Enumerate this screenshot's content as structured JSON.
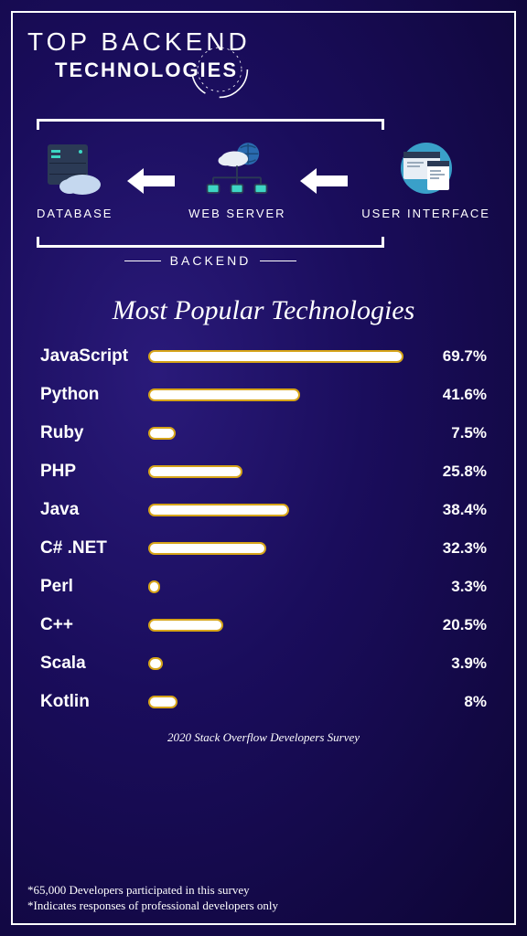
{
  "header": {
    "line1": "TOP BACKEND",
    "line2": "TECHNOLOGIES"
  },
  "diagram": {
    "nodes": [
      "DATABASE",
      "WEB SERVER",
      "USER INTERFACE"
    ],
    "group_label": "BACKEND"
  },
  "chart": {
    "title": "Most Popular Technologies",
    "source": "2020 Stack Overflow Developers Survey"
  },
  "chart_data": {
    "type": "bar",
    "title": "Most Popular Technologies",
    "categories": [
      "JavaScript",
      "Python",
      "Ruby",
      "PHP",
      "Java",
      "C# .NET",
      "Perl",
      "C++",
      "Scala",
      "Kotlin"
    ],
    "values": [
      69.7,
      41.6,
      7.5,
      25.8,
      38.4,
      32.3,
      3.3,
      20.5,
      3.9,
      8.0
    ],
    "xlabel": "",
    "ylabel": "",
    "ylim": [
      0,
      70
    ],
    "value_suffix": "%"
  },
  "footnotes": [
    "*65,000 Developers participated in this survey",
    "*Indicates responses of professional developers only"
  ]
}
